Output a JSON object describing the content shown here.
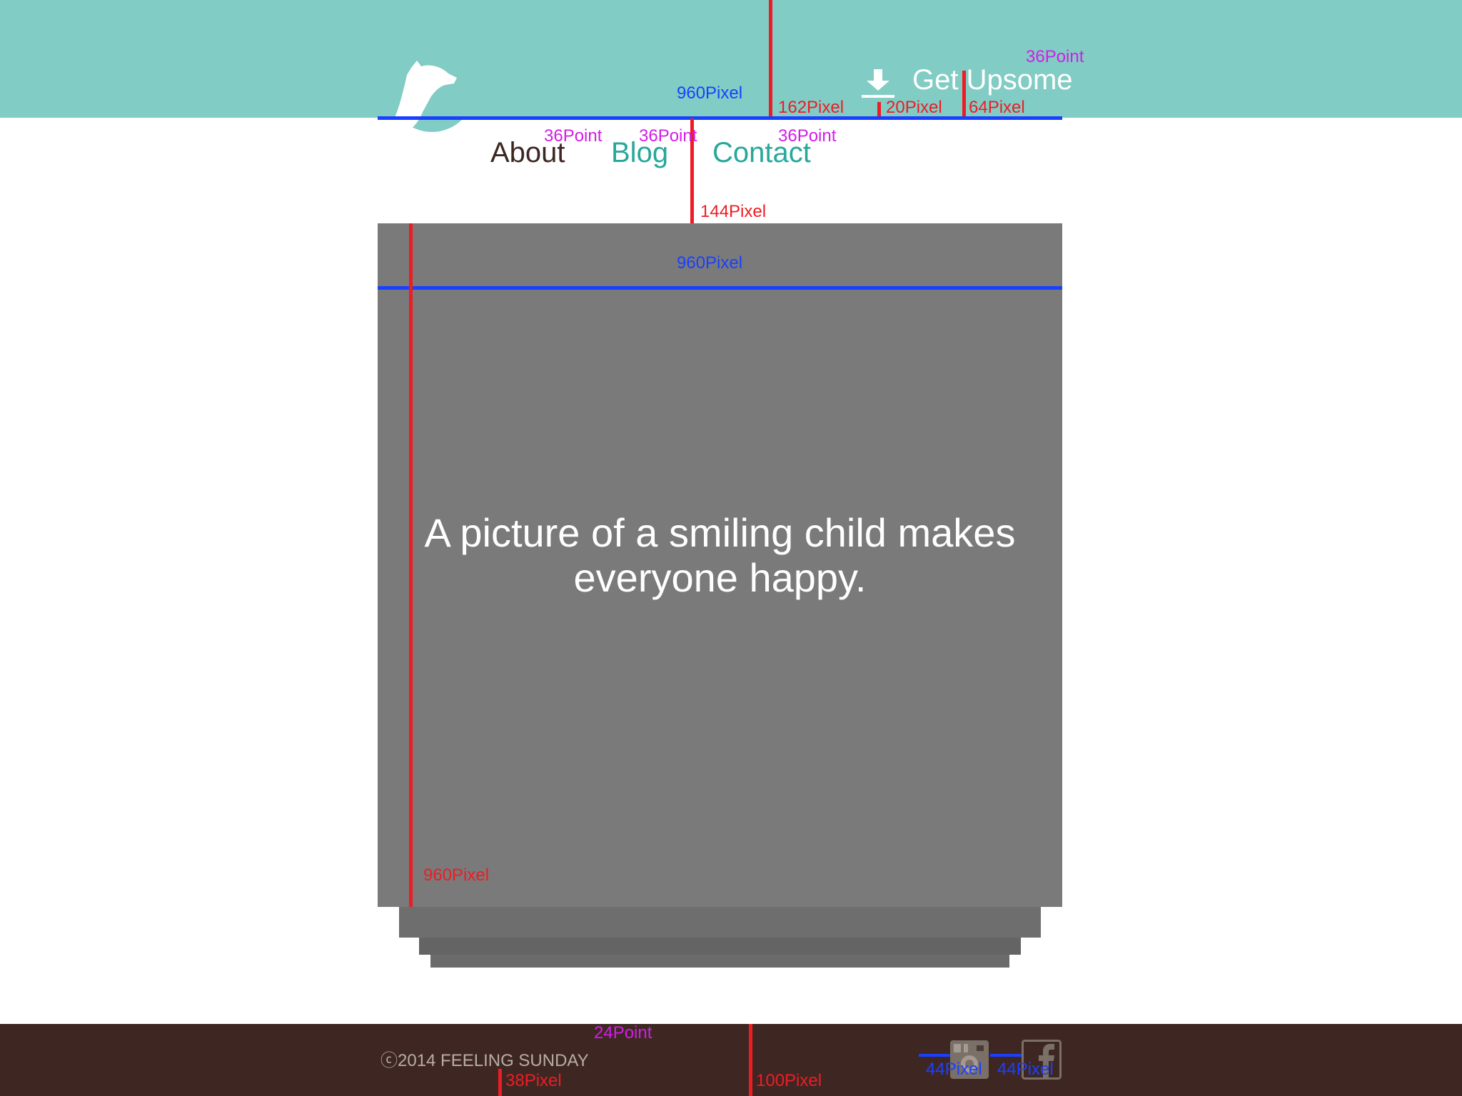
{
  "header": {
    "get_label": "Get Upsome",
    "logo_icon": "giraffe-logo-icon",
    "download_icon": "download-icon",
    "background": "#81ccc4"
  },
  "nav": {
    "about": "About",
    "blog": "Blog",
    "contact": "Contact",
    "active_color": "#3e2723",
    "link_color": "#27a89a"
  },
  "hero": {
    "caption": "A picture of a smiling child makes everyone happy.",
    "background": "#7a7a7a"
  },
  "footer": {
    "copyright": "ⓒ2014 FEELING SUNDAY",
    "background": "#3e2723",
    "icons": [
      "instagram-icon",
      "facebook-icon"
    ]
  },
  "annotations": {
    "header_width": "960Pixel",
    "header_height": "162Pixel",
    "icon_gap": "20Pixel",
    "get_height": "64Pixel",
    "get_font": "36Point",
    "about_font": "36Point",
    "blog_font": "36Point",
    "contact_font": "36Point",
    "nav_gap": "144Pixel",
    "hero_width": "960Pixel",
    "hero_height": "960Pixel",
    "footer_font": "24Point",
    "footer_text_offset": "38Pixel",
    "footer_height": "100Pixel",
    "ig_size": "44Pixel",
    "fb_size": "44Pixel"
  }
}
